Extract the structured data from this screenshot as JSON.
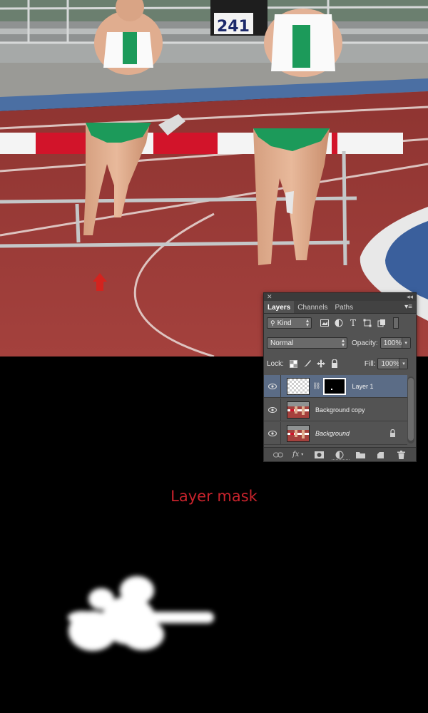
{
  "photo": {
    "bib_number": "241",
    "colors": {
      "track": "#9c3d3a",
      "hurdle_red": "#d2142a",
      "jersey_green": "#1c9a5a",
      "water": "#3a5f9c"
    }
  },
  "layers_panel": {
    "title_collapse": "◂◂",
    "tabs": [
      {
        "label": "Layers",
        "active": true
      },
      {
        "label": "Channels",
        "active": false
      },
      {
        "label": "Paths",
        "active": false
      }
    ],
    "filter": {
      "kind_label": "Kind"
    },
    "blend_mode": "Normal",
    "opacity": {
      "label": "Opacity:",
      "value": "100%"
    },
    "lock": {
      "label": "Lock:"
    },
    "fill": {
      "label": "Fill:",
      "value": "100%"
    },
    "layers": [
      {
        "name": "Layer 1",
        "selected": true,
        "has_mask": true
      },
      {
        "name": "Background copy",
        "selected": false,
        "has_mask": false
      },
      {
        "name": "Background",
        "selected": false,
        "locked": true
      }
    ],
    "bottom_icons": [
      "link-icon",
      "fx-icon",
      "add-mask-icon",
      "adjustment-icon",
      "folder-icon",
      "new-layer-icon",
      "trash-icon"
    ],
    "fx_label": "fx"
  },
  "caption": "Layer mask",
  "accent_color": "#c8232c"
}
